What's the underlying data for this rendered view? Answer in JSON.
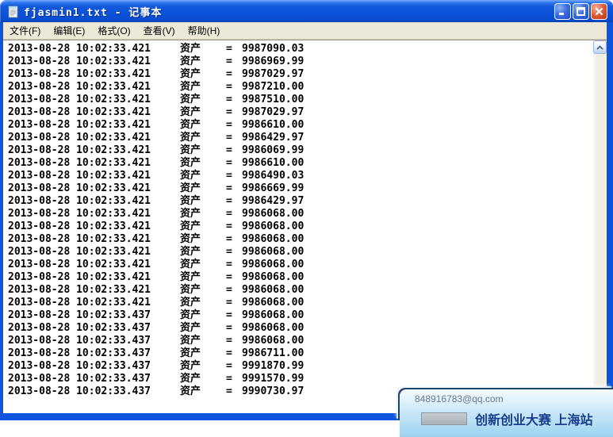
{
  "window": {
    "title": "fjasmin1.txt - 记事本",
    "icon": "notepad-icon",
    "controls": {
      "minimize": "minimize",
      "maximize": "maximize",
      "close": "close"
    }
  },
  "menu": {
    "items": [
      {
        "label": "文件(F)"
      },
      {
        "label": "编辑(E)"
      },
      {
        "label": "格式(O)"
      },
      {
        "label": "查看(V)"
      },
      {
        "label": "帮助(H)"
      }
    ]
  },
  "log": {
    "label": "资产",
    "equals": "=",
    "lines": [
      {
        "timestamp": "2013-08-28 10:02:33.421",
        "value": "9987090.03"
      },
      {
        "timestamp": "2013-08-28 10:02:33.421",
        "value": "9986969.99"
      },
      {
        "timestamp": "2013-08-28 10:02:33.421",
        "value": "9987029.97"
      },
      {
        "timestamp": "2013-08-28 10:02:33.421",
        "value": "9987210.00"
      },
      {
        "timestamp": "2013-08-28 10:02:33.421",
        "value": "9987510.00"
      },
      {
        "timestamp": "2013-08-28 10:02:33.421",
        "value": "9987029.97"
      },
      {
        "timestamp": "2013-08-28 10:02:33.421",
        "value": "9986610.00"
      },
      {
        "timestamp": "2013-08-28 10:02:33.421",
        "value": "9986429.97"
      },
      {
        "timestamp": "2013-08-28 10:02:33.421",
        "value": "9986069.99"
      },
      {
        "timestamp": "2013-08-28 10:02:33.421",
        "value": "9986610.00"
      },
      {
        "timestamp": "2013-08-28 10:02:33.421",
        "value": "9986490.03"
      },
      {
        "timestamp": "2013-08-28 10:02:33.421",
        "value": "9986669.99"
      },
      {
        "timestamp": "2013-08-28 10:02:33.421",
        "value": "9986429.97"
      },
      {
        "timestamp": "2013-08-28 10:02:33.421",
        "value": "9986068.00"
      },
      {
        "timestamp": "2013-08-28 10:02:33.421",
        "value": "9986068.00"
      },
      {
        "timestamp": "2013-08-28 10:02:33.421",
        "value": "9986068.00"
      },
      {
        "timestamp": "2013-08-28 10:02:33.421",
        "value": "9986068.00"
      },
      {
        "timestamp": "2013-08-28 10:02:33.421",
        "value": "9986068.00"
      },
      {
        "timestamp": "2013-08-28 10:02:33.421",
        "value": "9986068.00"
      },
      {
        "timestamp": "2013-08-28 10:02:33.421",
        "value": "9986068.00"
      },
      {
        "timestamp": "2013-08-28 10:02:33.421",
        "value": "9986068.00"
      },
      {
        "timestamp": "2013-08-28 10:02:33.437",
        "value": "9986068.00"
      },
      {
        "timestamp": "2013-08-28 10:02:33.437",
        "value": "9986068.00"
      },
      {
        "timestamp": "2013-08-28 10:02:33.437",
        "value": "9986068.00"
      },
      {
        "timestamp": "2013-08-28 10:02:33.437",
        "value": "9986711.00"
      },
      {
        "timestamp": "2013-08-28 10:02:33.437",
        "value": "9991870.99"
      },
      {
        "timestamp": "2013-08-28 10:02:33.437",
        "value": "9991570.99"
      },
      {
        "timestamp": "2013-08-28 10:02:33.437",
        "value": "9990730.97"
      }
    ]
  },
  "popup": {
    "email": "848916783@qq.com",
    "title": "创新创业大赛 上海站"
  },
  "colors": {
    "titlebar_blue": "#0a50d6",
    "menu_beige": "#ece9d8",
    "close_red": "#cf4527",
    "popup_border_navy": "#24416b",
    "popup_title_blue": "#173e8c",
    "scroll_track": "#f0eee2"
  }
}
